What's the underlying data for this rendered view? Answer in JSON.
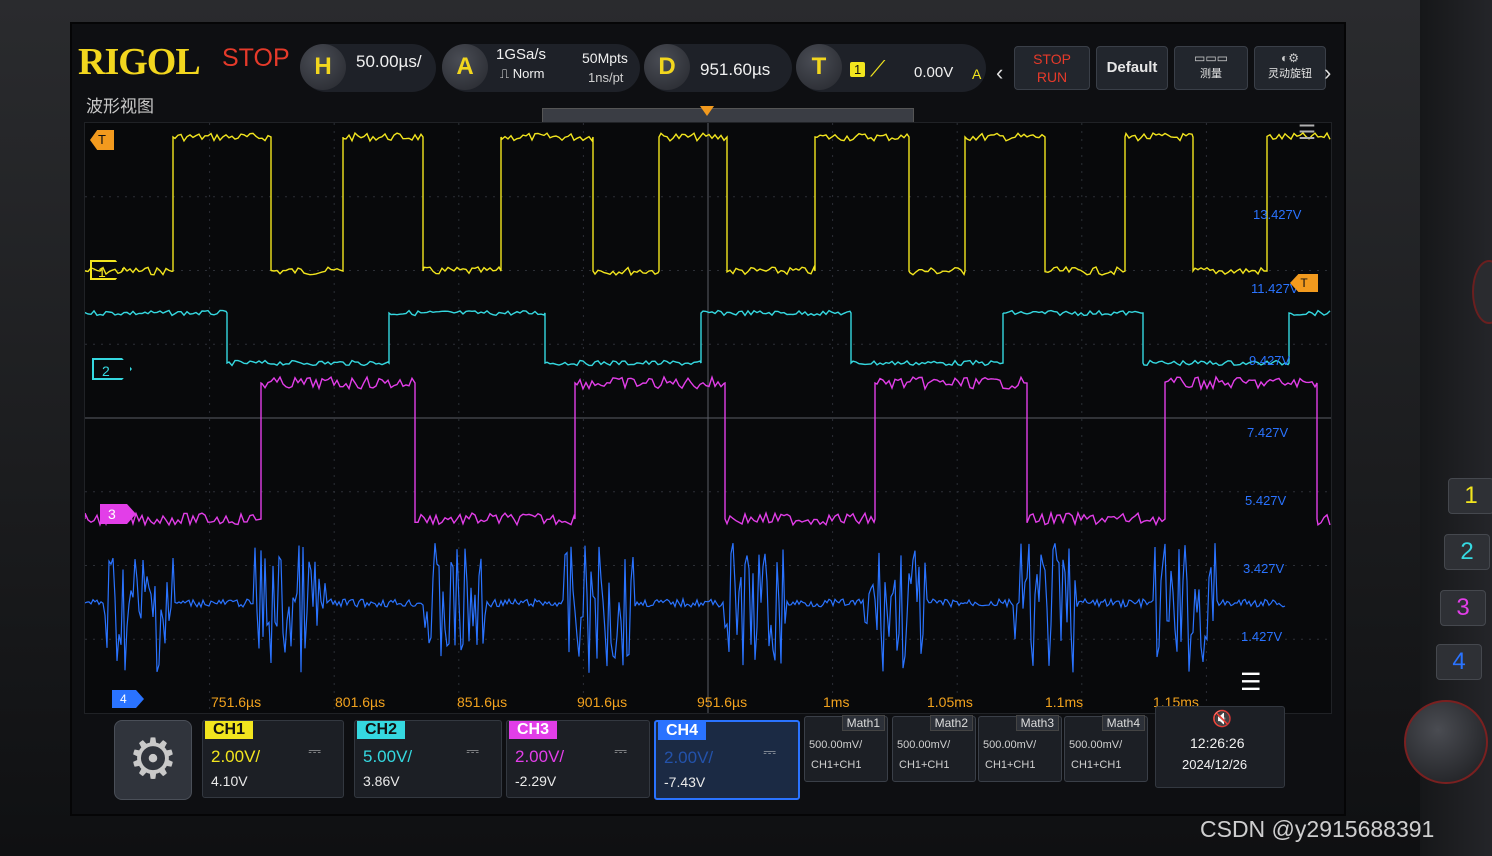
{
  "brand": "RIGOL",
  "run_state": "STOP",
  "horizontal": {
    "badge": "H",
    "timebase": "50.00µs/"
  },
  "acquire": {
    "badge": "A",
    "sample_rate": "1GSa/s",
    "mode": "Norm",
    "depth": "50Mpts",
    "resolution": "1ns/pt"
  },
  "delay": {
    "badge": "D",
    "value": "951.60µs"
  },
  "trigger": {
    "badge": "T",
    "source": "1",
    "level": "0.00V",
    "status": "A"
  },
  "buttons": {
    "stop_run_top": "STOP",
    "stop_run_bottom": "RUN",
    "default": "Default",
    "measure": "测量",
    "quick": "灵动旋钮"
  },
  "view_title": "波形视图",
  "markers": {
    "trigger_marker": "T",
    "ch1": "1",
    "ch2": "2",
    "ch3": "3",
    "ch4": "4"
  },
  "time_labels": [
    "751.6µs",
    "801.6µs",
    "851.6µs",
    "901.6µs",
    "951.6µs",
    "1ms",
    "1.05ms",
    "1.1ms",
    "1.15ms"
  ],
  "voltage_labels": [
    "13.427V",
    "11.427V",
    "9.427V",
    "7.427V",
    "5.427V",
    "3.427V",
    "1.427V"
  ],
  "channels": [
    {
      "label": "CH1",
      "scale": "2.00V/",
      "offset": "4.10V",
      "coupling": "⎓",
      "color": "#f2e51e"
    },
    {
      "label": "CH2",
      "scale": "5.00V/",
      "offset": "3.86V",
      "coupling": "⎓",
      "color": "#35d8e0"
    },
    {
      "label": "CH3",
      "scale": "2.00V/",
      "offset": "-2.29V",
      "coupling": "⎓",
      "color": "#e23ee8"
    },
    {
      "label": "CH4",
      "scale": "2.00V/",
      "offset": "-7.43V",
      "coupling": "⎓",
      "color": "#2a73ff"
    }
  ],
  "math": [
    {
      "label": "Math1",
      "scale": "500.00mV/",
      "source": "CH1+CH1"
    },
    {
      "label": "Math2",
      "scale": "500.00mV/",
      "source": "CH1+CH1"
    },
    {
      "label": "Math3",
      "scale": "500.00mV/",
      "source": "CH1+CH1"
    },
    {
      "label": "Math4",
      "scale": "500.00mV/",
      "source": "CH1+CH1"
    }
  ],
  "clock": {
    "time": "12:26:26",
    "date": "2024/12/26",
    "icon": "speaker-mute-icon"
  },
  "panel_buttons": [
    "1",
    "2",
    "3",
    "4"
  ],
  "watermark": "CSDN @y2915688391",
  "colors": {
    "ch1": "#f2e51e",
    "ch2": "#35d8e0",
    "ch3": "#e23ee8",
    "ch4": "#2a73ff",
    "stop": "#e53a2a",
    "brand": "#f2d61e"
  }
}
